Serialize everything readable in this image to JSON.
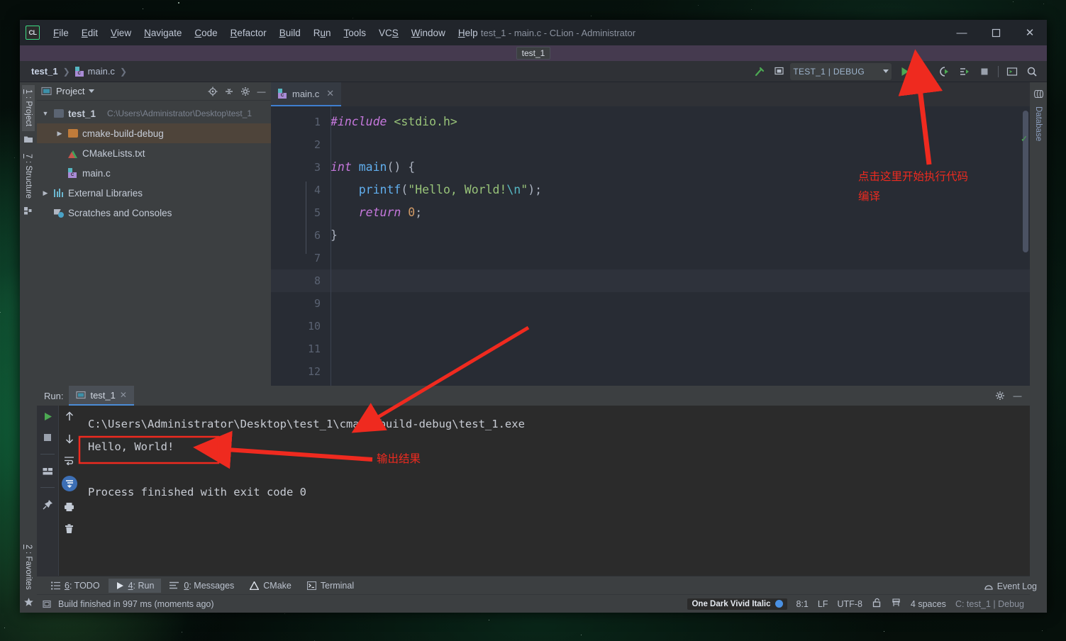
{
  "window": {
    "title": "test_1 - main.c - CLion - Administrator",
    "logo": "CL",
    "tooltip_badge": "test_1",
    "controls": {
      "minimize": "—",
      "maximize": "☐",
      "close": "✕"
    }
  },
  "menu": [
    {
      "label": "File",
      "mnemonic": "F"
    },
    {
      "label": "Edit",
      "mnemonic": "E"
    },
    {
      "label": "View",
      "mnemonic": "V"
    },
    {
      "label": "Navigate",
      "mnemonic": "N"
    },
    {
      "label": "Code",
      "mnemonic": "C"
    },
    {
      "label": "Refactor",
      "mnemonic": "R"
    },
    {
      "label": "Build",
      "mnemonic": "B"
    },
    {
      "label": "Run",
      "mnemonic": "u"
    },
    {
      "label": "Tools",
      "mnemonic": "T"
    },
    {
      "label": "VCS",
      "mnemonic": "S"
    },
    {
      "label": "Window",
      "mnemonic": "W"
    },
    {
      "label": "Help",
      "mnemonic": "H"
    }
  ],
  "navbar": {
    "crumbs": [
      "test_1",
      "main.c"
    ],
    "separator": "❯",
    "run_config": "TEST_1 | DEBUG",
    "icons": {
      "build": "build-hammer-icon",
      "select_target": "select-target-icon",
      "run": "run-icon",
      "debug": "debug-icon",
      "coverage": "run-with-coverage-icon",
      "profile": "profile-icon",
      "stop": "stop-icon",
      "terminal": "terminal-icon",
      "search": "search-everywhere-icon"
    }
  },
  "left_tool_tabs": [
    {
      "label": "1: Project",
      "mnemonic": "1",
      "active": true
    },
    {
      "label": "7: Structure",
      "mnemonic": "7",
      "active": false
    },
    {
      "label": "2: Favorites",
      "mnemonic": "2",
      "active": false
    }
  ],
  "right_tool_tabs": [
    {
      "label": "Database",
      "active": false
    }
  ],
  "project_panel": {
    "title": "Project",
    "header_icons": [
      "locate-icon",
      "collapse-all-icon",
      "settings-gear-icon",
      "hide-icon"
    ],
    "tree": [
      {
        "label": "test_1",
        "path": "C:\\Users\\Administrator\\Desktop\\test_1",
        "expanded": true,
        "indent": 0,
        "icon": "folder",
        "selected": false
      },
      {
        "label": "cmake-build-debug",
        "path": "",
        "expanded": false,
        "indent": 1,
        "icon": "folder-orange",
        "selected": true
      },
      {
        "label": "CMakeLists.txt",
        "path": "",
        "expanded": null,
        "indent": 1,
        "icon": "cmake",
        "selected": false
      },
      {
        "label": "main.c",
        "path": "",
        "expanded": null,
        "indent": 1,
        "icon": "c-file",
        "selected": false
      },
      {
        "label": "External Libraries",
        "path": "",
        "expanded": false,
        "indent": 0,
        "icon": "library",
        "selected": false
      },
      {
        "label": "Scratches and Consoles",
        "path": "",
        "expanded": null,
        "indent": 0,
        "icon": "scratch",
        "selected": false
      }
    ]
  },
  "editor": {
    "tabs": [
      {
        "label": "main.c",
        "active": true,
        "close": "✕"
      }
    ],
    "current_line": 8,
    "lines": [
      {
        "n": 1,
        "tokens": [
          {
            "t": "#include ",
            "c": "k-inc"
          },
          {
            "t": "<stdio.h>",
            "c": "k-hdr"
          }
        ],
        "indent": 0
      },
      {
        "n": 2,
        "tokens": [],
        "indent": 0
      },
      {
        "n": 3,
        "tokens": [
          {
            "t": "int",
            "c": "k-type"
          },
          {
            "t": " ",
            "c": "k-punct"
          },
          {
            "t": "main",
            "c": "k-fn"
          },
          {
            "t": "() {",
            "c": "k-punct"
          }
        ],
        "indent": 0,
        "run_marker": true,
        "fold": true
      },
      {
        "n": 4,
        "tokens": [
          {
            "t": "    ",
            "c": "k-punct"
          },
          {
            "t": "printf",
            "c": "k-fn"
          },
          {
            "t": "(",
            "c": "k-punct"
          },
          {
            "t": "\"Hello, World!",
            "c": "k-str"
          },
          {
            "t": "\\n",
            "c": "k-esc"
          },
          {
            "t": "\"",
            "c": "k-str"
          },
          {
            "t": ");",
            "c": "k-punct"
          }
        ],
        "indent": 1
      },
      {
        "n": 5,
        "tokens": [
          {
            "t": "    ",
            "c": "k-punct"
          },
          {
            "t": "return",
            "c": "k-type"
          },
          {
            "t": " ",
            "c": "k-punct"
          },
          {
            "t": "0",
            "c": "k-num"
          },
          {
            "t": ";",
            "c": "k-punct"
          }
        ],
        "indent": 1
      },
      {
        "n": 6,
        "tokens": [
          {
            "t": "}",
            "c": "k-punct"
          }
        ],
        "indent": 0,
        "fold_end": true
      },
      {
        "n": 7,
        "tokens": [],
        "indent": 0
      },
      {
        "n": 8,
        "tokens": [],
        "indent": 0
      },
      {
        "n": 9,
        "tokens": [],
        "indent": 0
      },
      {
        "n": 10,
        "tokens": [],
        "indent": 0
      },
      {
        "n": 11,
        "tokens": [],
        "indent": 0
      },
      {
        "n": 12,
        "tokens": [],
        "indent": 0
      }
    ]
  },
  "run_panel": {
    "label": "Run:",
    "tab": "test_1",
    "tab_close": "✕",
    "header_icons": [
      "settings-gear-icon",
      "hide-icon"
    ],
    "gutter_left": [
      "rerun-icon",
      "stop-icon",
      "layout-icon",
      "pin-icon"
    ],
    "gutter_right": [
      "up-icon",
      "down-icon",
      "soft-wrap-icon",
      "scroll-to-end-icon",
      "print-icon",
      "trash-icon"
    ],
    "console": [
      "C:\\Users\\Administrator\\Desktop\\test_1\\cmake-build-debug\\test_1.exe",
      "Hello, World!",
      "",
      "Process finished with exit code 0"
    ]
  },
  "bottom_tabs": [
    {
      "label": "6: TODO",
      "mnemonic": "6",
      "icon": "todo-icon",
      "active": false
    },
    {
      "label": "4: Run",
      "mnemonic": "4",
      "icon": "run-icon",
      "active": true
    },
    {
      "label": "0: Messages",
      "mnemonic": "0",
      "icon": "messages-icon",
      "active": false
    },
    {
      "label": "CMake",
      "mnemonic": "",
      "icon": "cmake-icon",
      "active": false
    },
    {
      "label": "Terminal",
      "mnemonic": "",
      "icon": "terminal-icon",
      "active": false
    }
  ],
  "status_bar": {
    "build_message": "Build finished in 997 ms (moments ago)",
    "event_log": "Event Log",
    "theme": "One Dark Vivid Italic",
    "caret": "8:1",
    "line_separator": "LF",
    "encoding": "UTF-8",
    "indent": "4 spaces",
    "config": "C: test_1 | Debug",
    "icons": [
      "lock-icon",
      "inspection-icon"
    ]
  },
  "annotations": {
    "run_button_note": "点击这里开始执行代码\n编译",
    "output_note": "输出结果",
    "color": "#ef2a1f"
  },
  "colors": {
    "accent_blue": "#3f7fd0",
    "run_green": "#4ca953",
    "annotation_red": "#ef2a1f",
    "panel_bg": "#3c3f41",
    "editor_bg": "#282c34"
  }
}
